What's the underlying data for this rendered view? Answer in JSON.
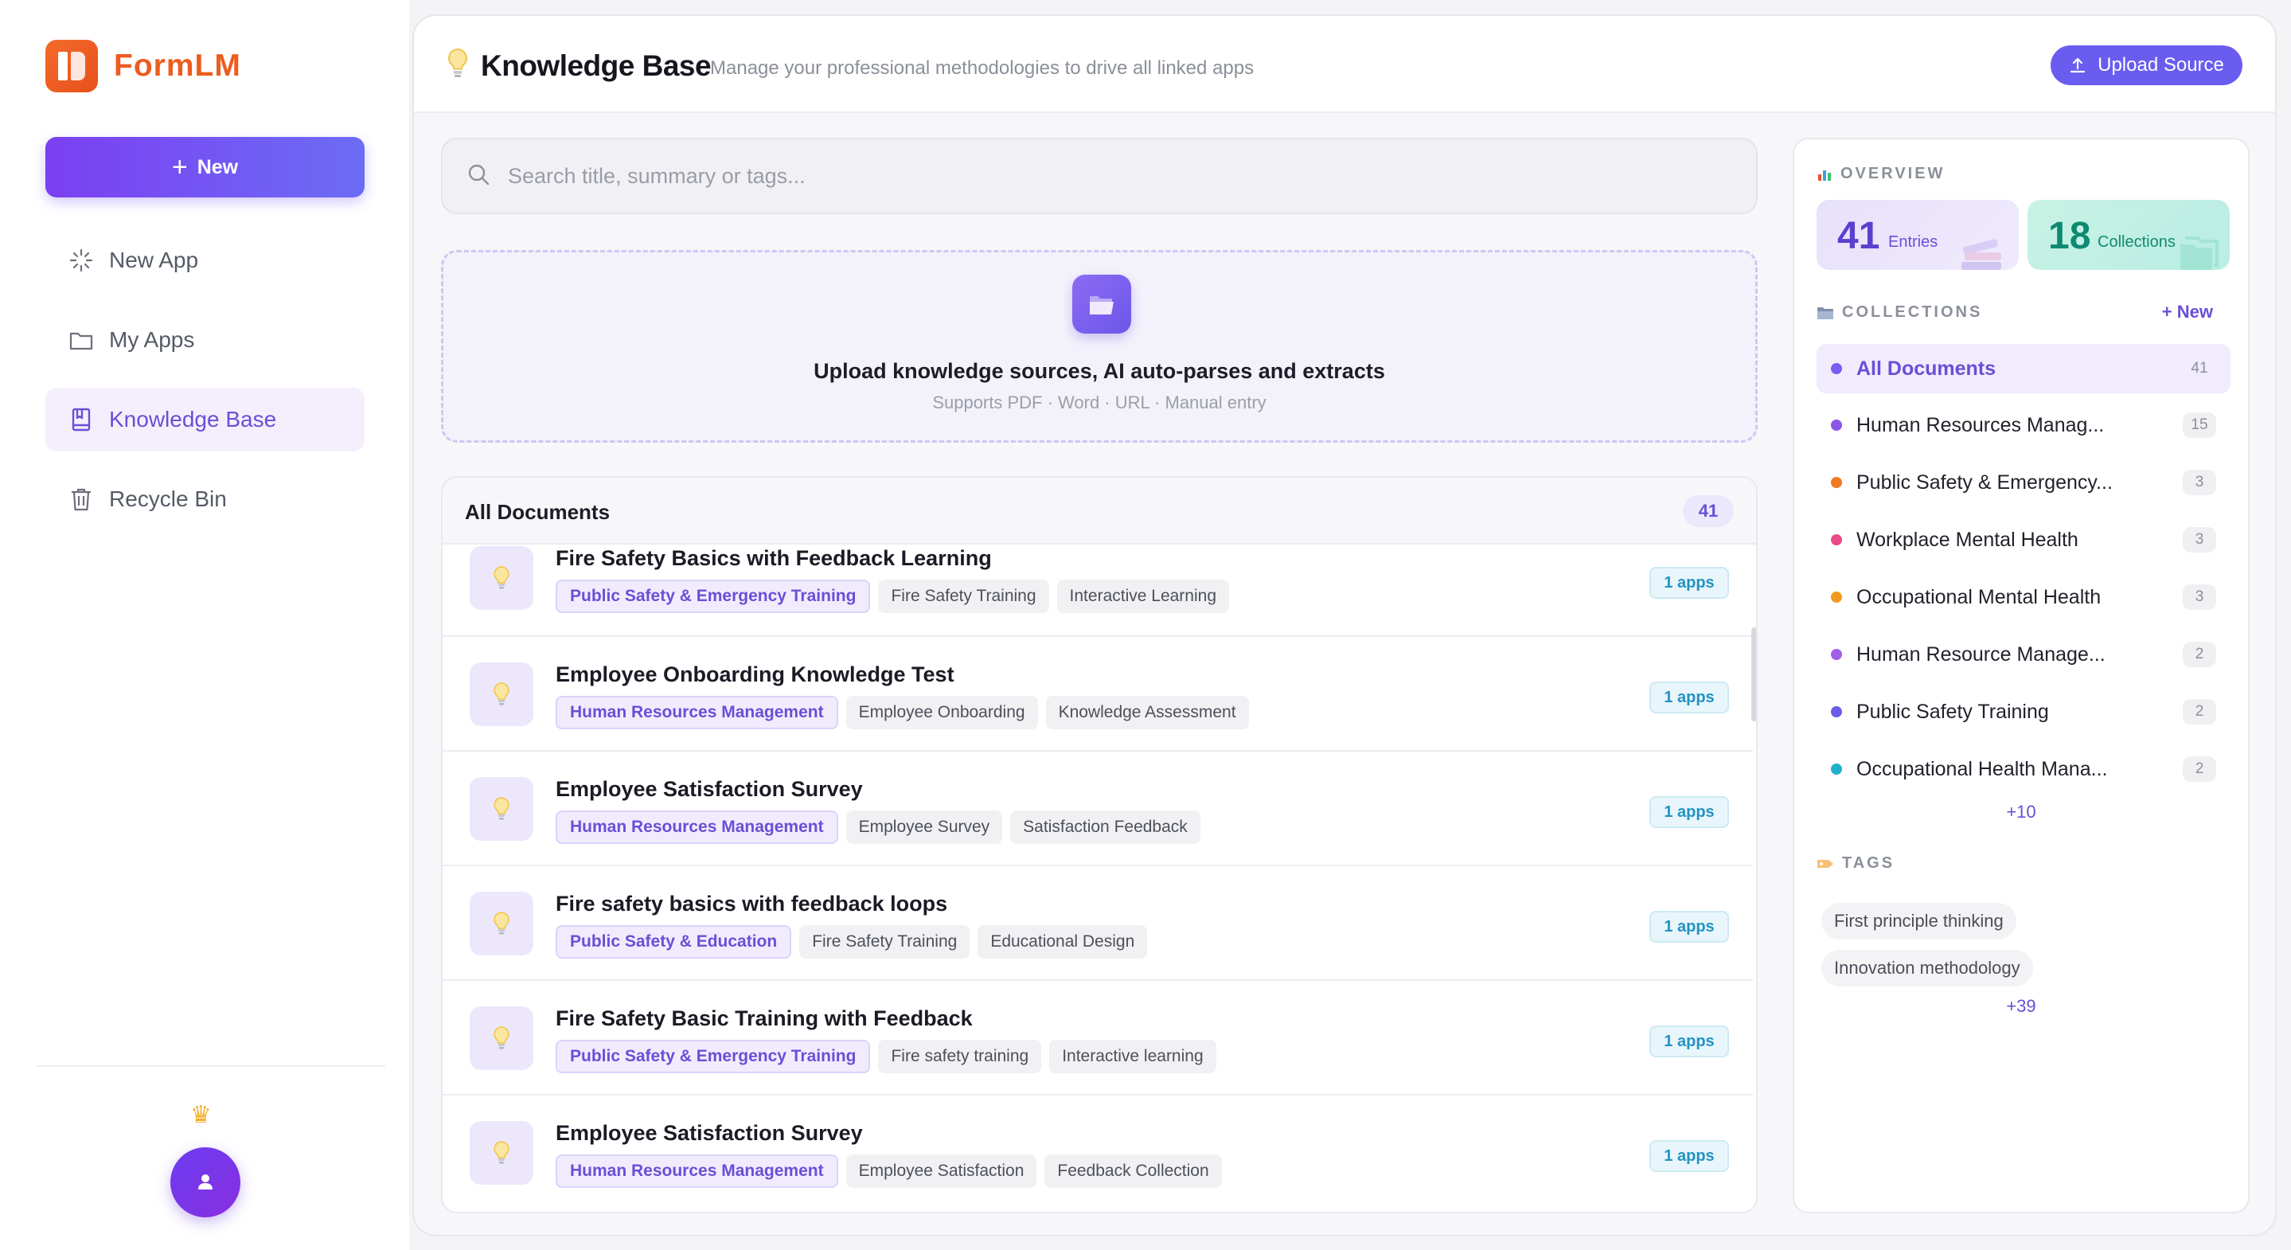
{
  "app": {
    "name": "FormLM",
    "new_label": "New"
  },
  "sidebar": {
    "items": [
      {
        "label": "New App",
        "icon": "sparkle-icon",
        "active": false
      },
      {
        "label": "My Apps",
        "icon": "folder-icon",
        "active": false
      },
      {
        "label": "Knowledge Base",
        "icon": "book-icon",
        "active": true
      },
      {
        "label": "Recycle Bin",
        "icon": "trash-icon",
        "active": false
      }
    ]
  },
  "header": {
    "title": "Knowledge Base",
    "subtitle": "Manage your professional methodologies to drive all linked apps",
    "upload_label": "Upload Source"
  },
  "search": {
    "placeholder": "Search title, summary or tags..."
  },
  "dropzone": {
    "title": "Upload knowledge sources, AI auto-parses and extracts",
    "subtitle": "Supports PDF · Word · URL · Manual entry"
  },
  "documents": {
    "title": "All Documents",
    "count": "41",
    "rows": [
      {
        "title": "Fire Safety Basics with Feedback Learning",
        "tags": [
          "Public Safety & Emergency Training",
          "Fire Safety Training",
          "Interactive Learning"
        ],
        "apps": "1 apps"
      },
      {
        "title": "Employee Onboarding Knowledge Test",
        "tags": [
          "Human Resources Management",
          "Employee Onboarding",
          "Knowledge Assessment"
        ],
        "apps": "1 apps"
      },
      {
        "title": "Employee Satisfaction Survey",
        "tags": [
          "Human Resources Management",
          "Employee Survey",
          "Satisfaction Feedback"
        ],
        "apps": "1 apps"
      },
      {
        "title": "Fire safety basics with feedback loops",
        "tags": [
          "Public Safety & Education",
          "Fire Safety Training",
          "Educational Design"
        ],
        "apps": "1 apps"
      },
      {
        "title": "Fire Safety Basic Training with Feedback",
        "tags": [
          "Public Safety & Emergency Training",
          "Fire safety training",
          "Interactive learning"
        ],
        "apps": "1 apps"
      },
      {
        "title": "Employee Satisfaction Survey",
        "tags": [
          "Human Resources Management",
          "Employee Satisfaction",
          "Feedback Collection"
        ],
        "apps": "1 apps"
      }
    ]
  },
  "overview": {
    "label": "OVERVIEW",
    "entries_count": "41",
    "entries_label": "Entries",
    "collections_count": "18",
    "collections_label": "Collections"
  },
  "collections": {
    "label": "COLLECTIONS",
    "new_label": "+ New",
    "items": [
      {
        "name": "All Documents",
        "count": "41",
        "color": "#7b5cf0",
        "active": true
      },
      {
        "name": "Human Resources Manag...",
        "count": "15",
        "color": "#8a56e8",
        "active": false
      },
      {
        "name": "Public Safety & Emergency...",
        "count": "3",
        "color": "#f07a24",
        "active": false
      },
      {
        "name": "Workplace Mental Health",
        "count": "3",
        "color": "#e84a8a",
        "active": false
      },
      {
        "name": "Occupational Mental Health",
        "count": "3",
        "color": "#f29a1f",
        "active": false
      },
      {
        "name": "Human Resource Manage...",
        "count": "2",
        "color": "#a35ee8",
        "active": false
      },
      {
        "name": "Public Safety Training",
        "count": "2",
        "color": "#6b5ce8",
        "active": false
      },
      {
        "name": "Occupational Health Mana...",
        "count": "2",
        "color": "#1fb0c9",
        "active": false
      }
    ],
    "more": "+10"
  },
  "tags": {
    "label": "TAGS",
    "items": [
      "First principle thinking",
      "Innovation methodology"
    ],
    "more": "+39"
  }
}
